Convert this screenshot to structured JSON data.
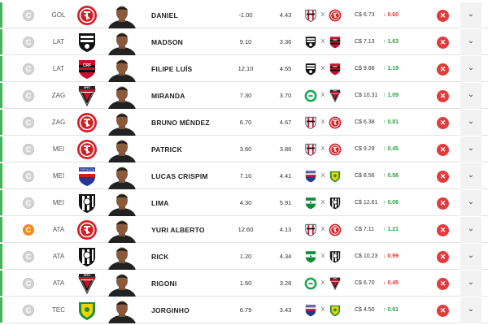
{
  "currency": "C$",
  "vs_separator": "X",
  "captain_glyph": "C",
  "remove_glyph": "✕",
  "expand_glyph": "⌄",
  "colors": {
    "row_bar": "#45b35d",
    "captain_active": "#f28a1c",
    "remove": "#e33b3b",
    "var_up": "#2aa347",
    "var_down": "#e33636"
  },
  "players": [
    {
      "pos": "GOL",
      "name": "DANIEL",
      "avg": "-1.00",
      "last": "4.43",
      "club": "internacional",
      "home": "atletico-go",
      "away": "internacional",
      "price": "6.73",
      "var": "0.60",
      "dir": "down",
      "captain": false
    },
    {
      "pos": "LAT",
      "name": "MADSON",
      "avg": "9.10",
      "last": "3.36",
      "club": "santos",
      "home": "santos",
      "away": "flamengo",
      "price": "7.13",
      "var": "1.63",
      "dir": "up",
      "captain": false
    },
    {
      "pos": "LAT",
      "name": "FILIPE LUÍS",
      "avg": "12.10",
      "last": "4.55",
      "club": "flamengo",
      "home": "santos",
      "away": "flamengo",
      "price": "9.88",
      "var": "1.19",
      "dir": "up",
      "captain": false
    },
    {
      "pos": "ZAG",
      "name": "MIRANDA",
      "avg": "7.30",
      "last": "3.70",
      "club": "sao-paulo",
      "home": "juventude",
      "away": "sao-paulo",
      "price": "10.31",
      "var": "1.09",
      "dir": "up",
      "captain": false
    },
    {
      "pos": "ZAG",
      "name": "BRUNO MÉNDEZ",
      "avg": "6.70",
      "last": "4.67",
      "club": "internacional",
      "home": "atletico-go",
      "away": "internacional",
      "price": "6.38",
      "var": "0.81",
      "dir": "up",
      "captain": false
    },
    {
      "pos": "MEI",
      "name": "PATRICK",
      "avg": "3.60",
      "last": "3.86",
      "club": "internacional",
      "home": "atletico-go",
      "away": "internacional",
      "price": "9.29",
      "var": "0.45",
      "dir": "up",
      "captain": false
    },
    {
      "pos": "MEI",
      "name": "LUCAS CRISPIM",
      "avg": "7.10",
      "last": "4.41",
      "club": "fortaleza",
      "home": "fortaleza",
      "away": "cuiaba",
      "price": "8.56",
      "var": "0.56",
      "dir": "up",
      "captain": false
    },
    {
      "pos": "MEI",
      "name": "LIMA",
      "avg": "4.30",
      "last": "5.91",
      "club": "ceara",
      "home": "america-mg",
      "away": "ceara",
      "price": "12.61",
      "var": "0.06",
      "dir": "up",
      "captain": false
    },
    {
      "pos": "ATA",
      "name": "YURI ALBERTO",
      "avg": "12.60",
      "last": "4.13",
      "club": "internacional",
      "home": "atletico-go",
      "away": "internacional",
      "price": "7.11",
      "var": "1.21",
      "dir": "up",
      "captain": true
    },
    {
      "pos": "ATA",
      "name": "RICK",
      "avg": "1.20",
      "last": "4.34",
      "club": "ceara",
      "home": "america-mg",
      "away": "ceara",
      "price": "10.23",
      "var": "0.99",
      "dir": "down",
      "captain": false
    },
    {
      "pos": "ATA",
      "name": "RIGONI",
      "avg": "1.60",
      "last": "3.28",
      "club": "sao-paulo",
      "home": "juventude",
      "away": "sao-paulo",
      "price": "6.70",
      "var": "0.45",
      "dir": "down",
      "captain": false
    },
    {
      "pos": "TEC",
      "name": "JORGINHO",
      "avg": "6.79",
      "last": "3.43",
      "club": "cuiaba",
      "home": "fortaleza",
      "away": "cuiaba",
      "price": "4.50",
      "var": "0.61",
      "dir": "up",
      "captain": false
    }
  ]
}
